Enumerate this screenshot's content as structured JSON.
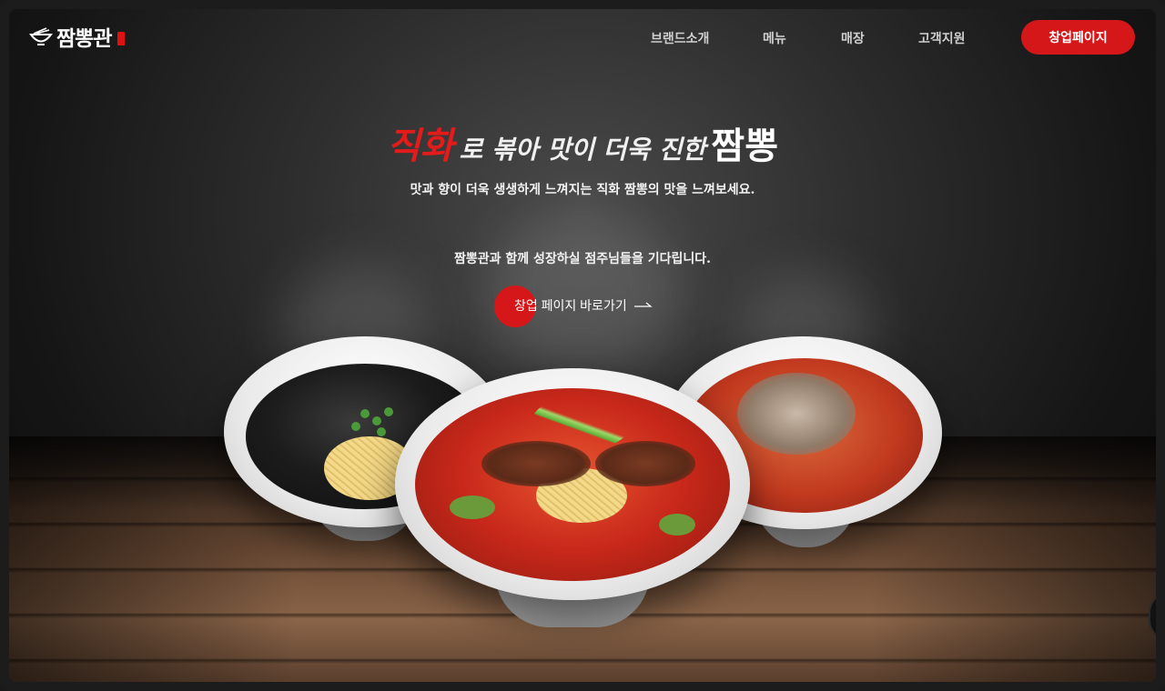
{
  "brand": {
    "name": "짬뽕관",
    "logo_icon": "bowl-logo-icon"
  },
  "nav": {
    "items": [
      {
        "label": "브랜드소개"
      },
      {
        "label": "메뉴"
      },
      {
        "label": "매장"
      },
      {
        "label": "고객지원"
      }
    ],
    "cta_label": "창업페이지"
  },
  "hero": {
    "headline_accent": "직화",
    "headline_middle": "로 볶아 맛이 더욱 진한",
    "headline_end": "짬뽕",
    "subheadline": "맛과 향이 더욱 생생하게 느껴지는 직화 짬뽕의 맛을 느껴보세요.",
    "invite_text": "짬뽕관과 함께 성장하실 점주님들을 기다립니다.",
    "cta_label": "창업 페이지 바로가기",
    "cta_arrow_icon": "arrow-right-icon"
  },
  "colors": {
    "accent": "#d6171a",
    "headline_red": "#e31b1b",
    "nav_text": "#cfcfcf",
    "background": "#151515"
  }
}
